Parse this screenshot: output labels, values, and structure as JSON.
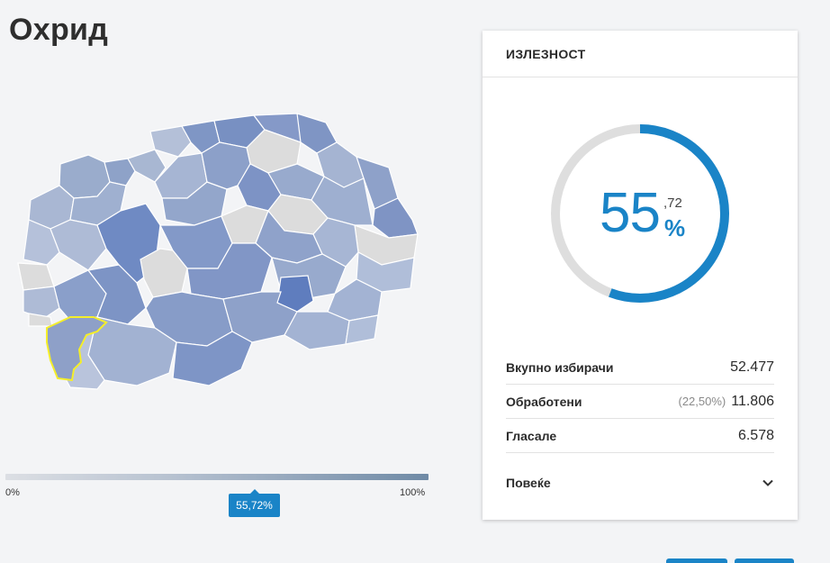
{
  "header": {
    "title": "Охрид"
  },
  "scale": {
    "min_label": "0%",
    "max_label": "100%",
    "marker_label": "55,72%",
    "marker_value": 0.5572
  },
  "turnout_card": {
    "title": "ИЗЛЕЗНОСТ",
    "percent_whole": "55",
    "percent_decimal": ",72",
    "percent_sign": "%",
    "percent_value": 55.72,
    "stats": [
      {
        "label": "Вкупно избирачи",
        "note": "",
        "value": "52.477"
      },
      {
        "label": "Обработени",
        "note": "(22,50%)",
        "value": "11.806"
      },
      {
        "label": "Гласале",
        "note": "",
        "value": "6.578"
      }
    ],
    "more_label": "Повеќе"
  },
  "colors": {
    "accent": "#1a84c7",
    "gauge_track": "#dedede",
    "highlight": "#f4ee2a"
  },
  "icons": {
    "more": "chevron-down-icon"
  }
}
